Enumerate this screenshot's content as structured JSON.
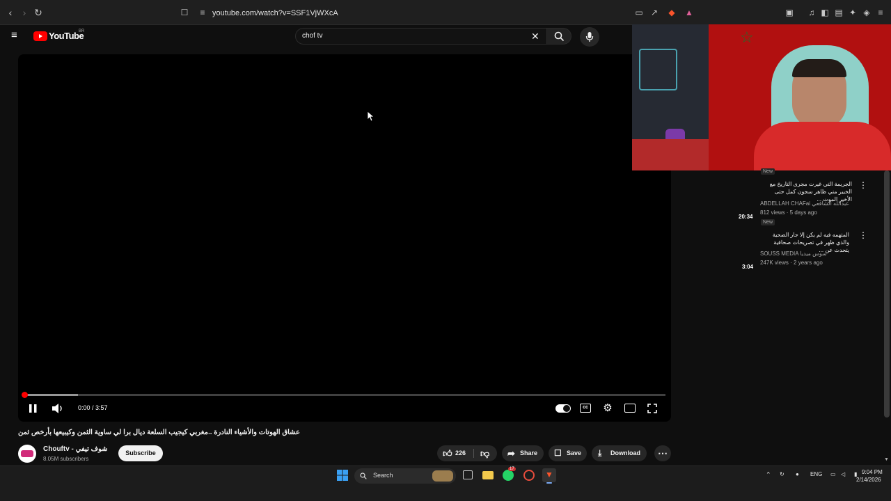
{
  "browser": {
    "url": "youtube.com/watch?v=SSF1VjWXcA"
  },
  "youtube": {
    "logo_text": "YouTube",
    "country_code": "BR",
    "search": {
      "value": "chof tv"
    }
  },
  "player": {
    "time": "0:00 / 3:57",
    "progress_fraction": 0.0,
    "buffer_fraction": 0.085
  },
  "video": {
    "title": "عشاق الهوتات والأشياء النادرة ..مغربي كيجيب السلعة ديال برا لي ساوية الثمن وكيبيعها بأرخص ثمن",
    "channel_name": "Chouftv - شوف تيفي",
    "subscribers": "8.05M subscribers",
    "subscribe_label": "Subscribe",
    "likes": "226",
    "share_label": "Share",
    "save_label": "Save",
    "download_label": "Download"
  },
  "sidebar": {
    "top_new_badge": "New",
    "items": [
      {
        "title": "الجريمة التي غيرت مجرى التاريخ مع الخبير مني ظاهر سجون كمل حتى الأخير الموت ...",
        "channel": "ABDELLAH CHAFai عبدالله الشافعي",
        "meta": "812 views · 5 days ago",
        "duration": "20:34",
        "badge": "New"
      },
      {
        "title": "المتهمه فيه لم يكن إلا جار الضحية والذي ظهر في تصريحات صحافية يتحدث عن ...",
        "channel": "SOUSS MEDIA سوس ميديا",
        "meta": "247K views · 2 years ago",
        "duration": "3:04",
        "badge": ""
      }
    ]
  },
  "taskbar": {
    "search_label": "Search",
    "lang": "ENG",
    "time": "9:04 PM",
    "date": "2/14/2026",
    "whatsapp_badge": "17"
  },
  "colors": {
    "youtube_red": "#ff0000",
    "background": "#0f0f0f"
  }
}
